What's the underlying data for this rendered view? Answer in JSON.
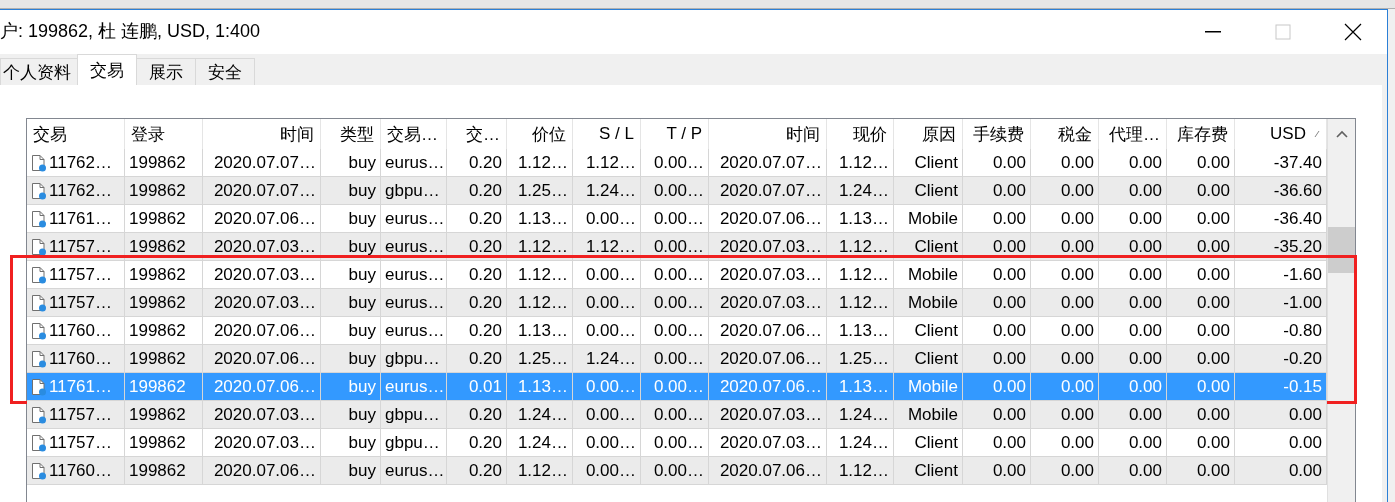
{
  "window": {
    "title": "户: 199862, 杜 连鹏, USD, 1:400"
  },
  "tabs": [
    {
      "label": "个人资料",
      "selected": false
    },
    {
      "label": "交易",
      "selected": true
    },
    {
      "label": "展示",
      "selected": false
    },
    {
      "label": "安全",
      "selected": false
    }
  ],
  "table": {
    "columns": [
      "交易",
      "登录",
      "时间",
      "类型",
      "交易…",
      "交…",
      "价位",
      "S / L",
      "T / P",
      "时间",
      "现价",
      "原因",
      "手续费",
      "税金",
      "代理…",
      "库存费",
      "USD"
    ],
    "rows": [
      {
        "cells": [
          "11762…",
          "199862",
          "2020.07.07…",
          "buy",
          "eurus…",
          "0.20",
          "1.12…",
          "1.12…",
          "0.00…",
          "2020.07.07…",
          "1.12…",
          "Client",
          "0.00",
          "0.00",
          "0.00",
          "0.00",
          "-37.40"
        ],
        "selected": false,
        "outlined": false
      },
      {
        "cells": [
          "11762…",
          "199862",
          "2020.07.07…",
          "buy",
          "gbpu…",
          "0.20",
          "1.25…",
          "1.24…",
          "0.00…",
          "2020.07.07…",
          "1.24…",
          "Client",
          "0.00",
          "0.00",
          "0.00",
          "0.00",
          "-36.60"
        ],
        "selected": false,
        "outlined": false
      },
      {
        "cells": [
          "11761…",
          "199862",
          "2020.07.06…",
          "buy",
          "eurus…",
          "0.20",
          "1.13…",
          "0.00…",
          "0.00…",
          "2020.07.06…",
          "1.13…",
          "Mobile",
          "0.00",
          "0.00",
          "0.00",
          "0.00",
          "-36.40"
        ],
        "selected": false,
        "outlined": false
      },
      {
        "cells": [
          "11757…",
          "199862",
          "2020.07.03…",
          "buy",
          "eurus…",
          "0.20",
          "1.12…",
          "1.12…",
          "0.00…",
          "2020.07.03…",
          "1.12…",
          "Client",
          "0.00",
          "0.00",
          "0.00",
          "0.00",
          "-35.20"
        ],
        "selected": false,
        "outlined": false
      },
      {
        "cells": [
          "11757…",
          "199862",
          "2020.07.03…",
          "buy",
          "eurus…",
          "0.20",
          "1.12…",
          "0.00…",
          "0.00…",
          "2020.07.03…",
          "1.12…",
          "Mobile",
          "0.00",
          "0.00",
          "0.00",
          "0.00",
          "-1.60"
        ],
        "selected": false,
        "outlined": true
      },
      {
        "cells": [
          "11757…",
          "199862",
          "2020.07.03…",
          "buy",
          "eurus…",
          "0.20",
          "1.12…",
          "0.00…",
          "0.00…",
          "2020.07.03…",
          "1.12…",
          "Mobile",
          "0.00",
          "0.00",
          "0.00",
          "0.00",
          "-1.00"
        ],
        "selected": false,
        "outlined": true
      },
      {
        "cells": [
          "11760…",
          "199862",
          "2020.07.06…",
          "buy",
          "eurus…",
          "0.20",
          "1.13…",
          "0.00…",
          "0.00…",
          "2020.07.06…",
          "1.13…",
          "Client",
          "0.00",
          "0.00",
          "0.00",
          "0.00",
          "-0.80"
        ],
        "selected": false,
        "outlined": true
      },
      {
        "cells": [
          "11760…",
          "199862",
          "2020.07.06…",
          "buy",
          "gbpu…",
          "0.20",
          "1.25…",
          "1.24…",
          "0.00…",
          "2020.07.06…",
          "1.25…",
          "Client",
          "0.00",
          "0.00",
          "0.00",
          "0.00",
          "-0.20"
        ],
        "selected": false,
        "outlined": true
      },
      {
        "cells": [
          "11761…",
          "199862",
          "2020.07.06…",
          "buy",
          "eurus…",
          "0.01",
          "1.13…",
          "0.00…",
          "0.00…",
          "2020.07.06…",
          "1.13…",
          "Mobile",
          "0.00",
          "0.00",
          "0.00",
          "0.00",
          "-0.15"
        ],
        "selected": true,
        "outlined": true
      },
      {
        "cells": [
          "11757…",
          "199862",
          "2020.07.03…",
          "buy",
          "gbpu…",
          "0.20",
          "1.24…",
          "0.00…",
          "0.00…",
          "2020.07.03…",
          "1.24…",
          "Mobile",
          "0.00",
          "0.00",
          "0.00",
          "0.00",
          "0.00"
        ],
        "selected": false,
        "outlined": false
      },
      {
        "cells": [
          "11757…",
          "199862",
          "2020.07.03…",
          "buy",
          "gbpu…",
          "0.20",
          "1.24…",
          "0.00…",
          "0.00…",
          "2020.07.03…",
          "1.24…",
          "Client",
          "0.00",
          "0.00",
          "0.00",
          "0.00",
          "0.00"
        ],
        "selected": false,
        "outlined": false
      },
      {
        "cells": [
          "11760…",
          "199862",
          "2020.07.06…",
          "buy",
          "eurus…",
          "0.20",
          "1.12…",
          "0.00…",
          "0.00…",
          "2020.07.06…",
          "1.12…",
          "Client",
          "0.00",
          "0.00",
          "0.00",
          "0.00",
          "0.00"
        ],
        "selected": false,
        "outlined": false
      }
    ]
  }
}
